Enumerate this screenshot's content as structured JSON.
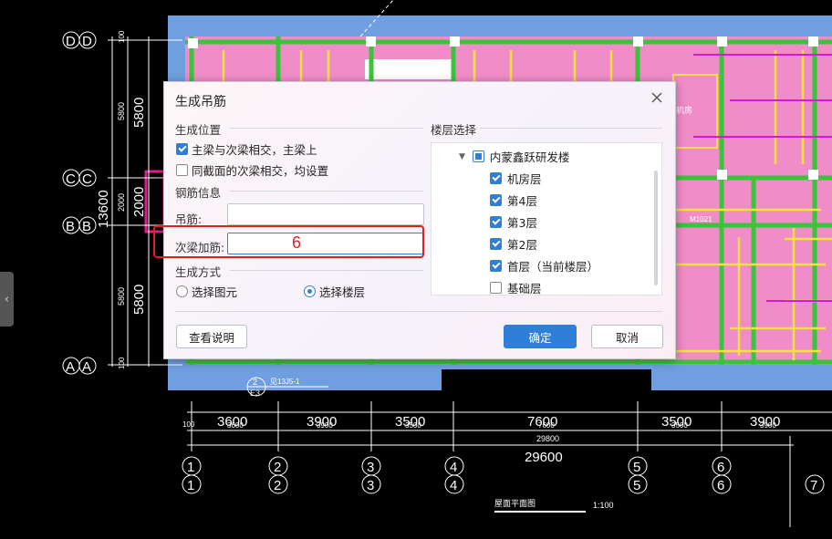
{
  "dialog": {
    "title": "生成吊筋",
    "position_section": "生成位置",
    "opt_main_secondary": "主梁与次梁相交，主梁上",
    "opt_main_secondary_checked": true,
    "opt_same_section": "同截面的次梁相交，均设置",
    "opt_same_section_checked": false,
    "rebar_section": "钢筋信息",
    "hanger_label": "吊筋:",
    "hanger_value": "",
    "secondary_label": "次梁加筋:",
    "secondary_value": "",
    "method_section": "生成方式",
    "method_select_element": "选择图元",
    "method_select_floor": "选择楼层",
    "method_selected": "选择楼层",
    "floor_section": "楼层选择",
    "tree_root": "内蒙鑫跃研发楼",
    "floors": [
      {
        "label": "机房层",
        "checked": true
      },
      {
        "label": "第4层",
        "checked": true
      },
      {
        "label": "第3层",
        "checked": true
      },
      {
        "label": "第2层",
        "checked": true
      },
      {
        "label": "首层（当前楼层）",
        "checked": true
      },
      {
        "label": "基础层",
        "checked": false
      }
    ],
    "help_button": "查看说明",
    "ok_button": "确定",
    "cancel_button": "取消"
  },
  "annotation": {
    "number": "6",
    "color": "#e02020"
  },
  "drawing": {
    "axis_rows_left": [
      "D",
      "C",
      "B",
      "A"
    ],
    "axis_rows_right": [
      "D",
      "C",
      "B",
      "A"
    ],
    "axis_columns_top": [
      "1",
      "2",
      "3",
      "4",
      "5",
      "6"
    ],
    "axis_columns_bottom": [
      "1",
      "2",
      "3",
      "4",
      "5",
      "6",
      "7"
    ],
    "dims_left_major": [
      "5800",
      "2000",
      "5800"
    ],
    "dims_left_minor": [
      "5800",
      "2000",
      "5800"
    ],
    "dim_left_total": "13600",
    "dims_left_small": [
      "100",
      "100"
    ],
    "dims_bottom_major": [
      "3600",
      "3900",
      "3500",
      "7600",
      "3500",
      "3900"
    ],
    "dims_bottom_minor": [
      "3600",
      "3900",
      "3500",
      "7600",
      "3500",
      "3900"
    ],
    "dim_bottom_total_small": "29800",
    "dim_bottom_total": "29600",
    "dim_bottom_offset": "100",
    "room_label": "机房",
    "door_label": "M1021",
    "drawing_title": "屋面平面图",
    "scale": "1:100",
    "detail_number": "2",
    "detail_sheet": "E3",
    "detail_ref": "见13J5-1",
    "colors": {
      "slab": "#f08cc8",
      "beam": "#39c43a",
      "rebar": "#f2e23a",
      "wall": "#6f9fe0",
      "accent": "#2f7fd8"
    }
  }
}
